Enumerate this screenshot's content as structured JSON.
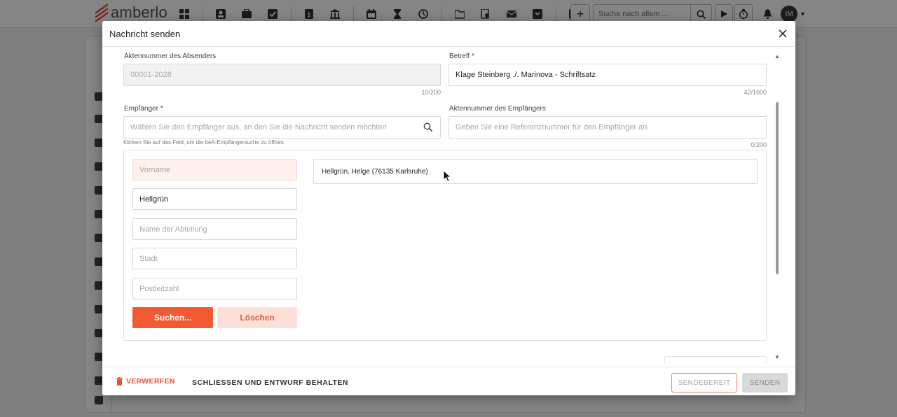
{
  "app": {
    "logo_text": "amberlo"
  },
  "topbar": {
    "icons": [
      "dashboard-icon",
      "contacts-icon",
      "matters-icon",
      "tasks-icon",
      "billing-icon",
      "bank-icon",
      "calendar-icon",
      "hourglass-icon",
      "time-history-icon",
      "folder-icon",
      "document-search-icon",
      "mail-icon",
      "inbox-icon",
      "reports-icon"
    ],
    "search_placeholder": "Suche nach allem ...",
    "avatar_initials": "IM"
  },
  "modal": {
    "title": "Nachricht senden",
    "sender_file_label": "Aktennummer des Absenders",
    "sender_file_value": "00001-2028",
    "sender_file_counter": "10/200",
    "subject_label": "Betreff *",
    "subject_value": "Klage Steinberg ./. Marinova - Schriftsatz",
    "subject_counter": "42/1000",
    "recipient_label": "Empfänger *",
    "recipient_placeholder": "Wählen Sie den Empfänger aus, an den Sie die Nachricht senden möchten",
    "recipient_hint": "Klicken Sie auf das Feld, um die beA-Empfängersuche zu öffnen.",
    "recipient_ref_label": "Aktennummer des Empfängers",
    "recipient_ref_placeholder": "Geben Sie eine Referenznummer für den Empfänger an",
    "recipient_ref_counter": "0/200",
    "search_form": {
      "firstname_placeholder": "Vorname",
      "lastname_value": "Hellgrün",
      "department_placeholder": "Name der Abteilung",
      "city_placeholder": "Stadt",
      "zip_placeholder": "Postleitzahl",
      "search_button": "Suchen...",
      "clear_button": "Löschen"
    },
    "results": [
      "Hellgrün, Helge (76135 Karlsruhe)"
    ],
    "footer": {
      "discard": "VERWERFEN",
      "close_keep_draft": "SCHLIESSEN UND ENTWURF BEHALTEN",
      "ready": "SENDEBEREIT",
      "send": "SENDEN"
    }
  },
  "colors": {
    "accent": "#f15a33",
    "accent_light": "#fde0d8",
    "overlay": "rgba(0,0,0,0.48)"
  }
}
